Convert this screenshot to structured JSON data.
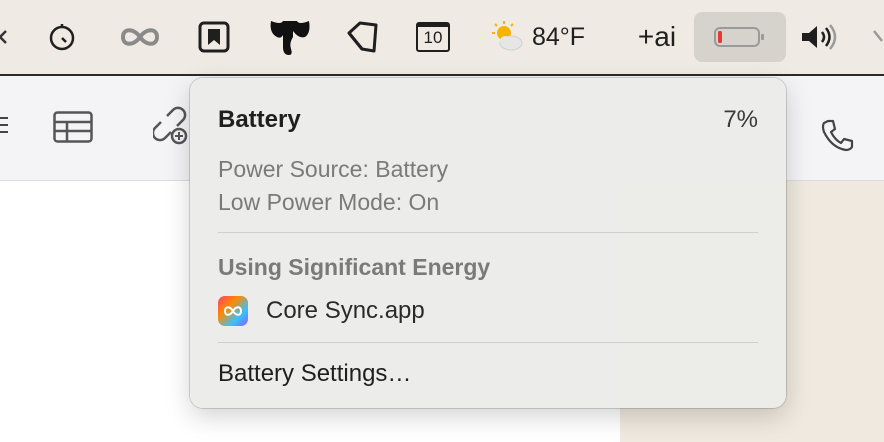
{
  "menubar": {
    "weather": {
      "icon": "partly-cloudy-icon",
      "temperature": "84°F"
    },
    "ai_label": "+ai",
    "calendar_day": "10",
    "icons": [
      "arrow-left-partial-icon",
      "timer-icon",
      "infinity-link-icon",
      "bookmark-app-icon",
      "elephant-icon",
      "pen-shape-icon",
      "calendar-icon",
      "battery-icon",
      "volume-icon",
      "extra-icon"
    ]
  },
  "toolbar": {
    "icons": [
      "list-icon",
      "table-icon",
      "link-add-icon",
      "phone-icon"
    ]
  },
  "battery_menu": {
    "title": "Battery",
    "percent": "7%",
    "power_source": "Power Source: Battery",
    "low_power_mode": "Low Power Mode: On",
    "section_title": "Using Significant Energy",
    "apps": [
      {
        "name": "Core Sync.app",
        "icon": "core-sync-app-icon"
      }
    ],
    "settings_label": "Battery Settings…"
  },
  "colors": {
    "menubar_bg": "#efebe4",
    "battery_low": "#e53935",
    "dropdown_bg": "#ebebe9"
  }
}
